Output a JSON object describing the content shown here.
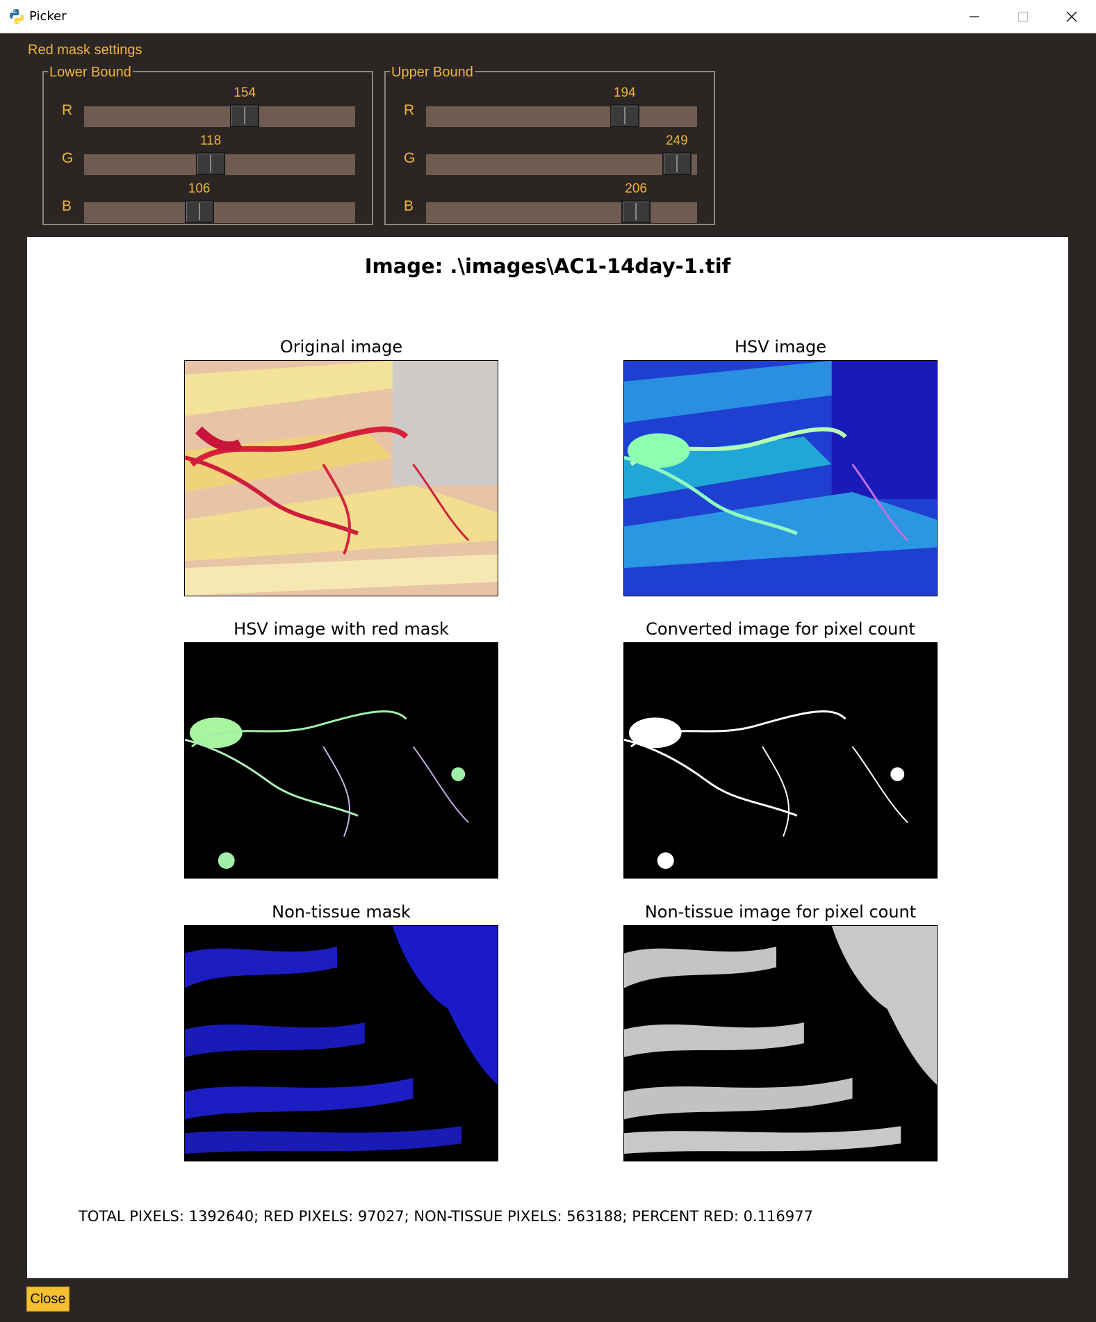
{
  "window": {
    "title": "Picker",
    "controls": [
      "minimize-icon",
      "maximize-icon",
      "close-icon"
    ]
  },
  "settings": {
    "title": "Red mask settings",
    "lower": {
      "legend": "Lower Bound",
      "channels": [
        {
          "label": "R",
          "value": "154"
        },
        {
          "label": "G",
          "value": "118"
        },
        {
          "label": "B",
          "value": "106"
        }
      ]
    },
    "upper": {
      "legend": "Upper Bound",
      "channels": [
        {
          "label": "R",
          "value": "194"
        },
        {
          "label": "G",
          "value": "249"
        },
        {
          "label": "B",
          "value": "206"
        }
      ]
    },
    "slider_max": 255
  },
  "figure": {
    "title": "Image: .\\images\\AC1-14day-1.tif",
    "subplots": [
      {
        "title": "Original image"
      },
      {
        "title": "HSV image"
      },
      {
        "title": "HSV image with red mask"
      },
      {
        "title": "Converted image for pixel count"
      },
      {
        "title": "Non-tissue mask"
      },
      {
        "title": "Non-tissue image for pixel count"
      }
    ],
    "stats": "TOTAL PIXELS: 1392640; RED PIXELS: 97027; NON-TISSUE PIXELS: 563188; PERCENT RED: 0.116977"
  },
  "footer": {
    "close_label": "Close"
  },
  "colors": {
    "background": "#2b2623",
    "accent_text": "#f0b43c",
    "slider_trough": "#6f5b4f",
    "close_button": "#f5c030"
  }
}
